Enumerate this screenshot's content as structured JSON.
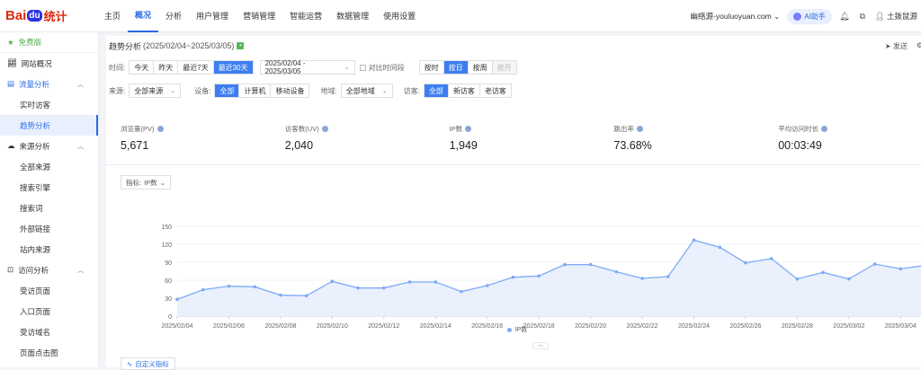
{
  "nav": {
    "logo_bai": "Bai",
    "logo_du": "du",
    "logo_tongji": "统计",
    "items": [
      "主页",
      "概况",
      "分析",
      "用户管理",
      "营销管理",
      "智能运营",
      "数据管理",
      "使用设置"
    ],
    "active_index": 1,
    "site": "幽络源-youluoyuan.com",
    "ai_label": "AI助手",
    "user": "土拨鼠源"
  },
  "sidebar": {
    "free": "免费版",
    "overview": "网站概况",
    "traffic": "流量分析",
    "traffic_items": [
      "实时访客",
      "趋势分析"
    ],
    "source": "来源分析",
    "source_items": [
      "全部来源",
      "搜索引擎",
      "搜索词",
      "外部链接",
      "站内来源"
    ],
    "visit": "访问分析",
    "visit_items": [
      "受访页面",
      "入口页面",
      "受访域名",
      "页面点击图"
    ]
  },
  "header": {
    "title": "趋势分析",
    "range": "(2025/02/04~2025/03/05)",
    "send": "发送"
  },
  "filters": {
    "time_label": "时间:",
    "time_options": [
      "今天",
      "昨天",
      "最近7天",
      "最近30天"
    ],
    "time_active": 3,
    "date_range": "2025/02/04 - 2025/03/05",
    "compare": "对比时间段",
    "gran_options": [
      "按时",
      "按日",
      "按周",
      "按月"
    ],
    "gran_active": 1,
    "gran_disabled": 3,
    "source_label": "来源:",
    "source_value": "全部来源",
    "device_label": "设备:",
    "device_options": [
      "全部",
      "计算机",
      "移动设备"
    ],
    "device_active": 0,
    "region_label": "地域:",
    "region_value": "全部地域",
    "visitor_label": "访客:",
    "visitor_options": [
      "全部",
      "新访客",
      "老访客"
    ],
    "visitor_active": 0
  },
  "metrics": [
    {
      "label": "浏览量(PV)",
      "value": "5,671"
    },
    {
      "label": "访客数(UV)",
      "value": "2,040"
    },
    {
      "label": "IP数",
      "value": "1,949"
    },
    {
      "label": "跳出率",
      "value": "73.68%"
    },
    {
      "label": "平均访问时长",
      "value": "00:03:49"
    }
  ],
  "indicator": {
    "label": "指标:",
    "value": "IP数"
  },
  "custom_metric": "自定义指标",
  "colors": {
    "accent": "#3d7ff0",
    "line": "#7eaaf5",
    "area": "#e8f0fd"
  },
  "chart_data": {
    "type": "area",
    "series": [
      {
        "name": "IP数",
        "values": [
          28,
          44,
          50,
          49,
          35,
          34,
          58,
          47,
          47,
          57,
          57,
          41,
          51,
          65,
          67,
          86,
          86,
          74,
          63,
          66,
          127,
          115,
          89,
          96,
          62,
          73,
          62,
          87,
          79,
          85
        ]
      }
    ],
    "x_tick_labels": [
      "2025/02/04",
      "2025/02/06",
      "2025/02/08",
      "2025/02/10",
      "2025/02/12",
      "2025/02/14",
      "2025/02/16",
      "2025/02/18",
      "2025/02/20",
      "2025/02/22",
      "2025/02/24",
      "2025/02/26",
      "2025/02/28",
      "2025/03/02",
      "2025/03/04"
    ],
    "yticks": [
      0,
      30,
      60,
      90,
      120,
      150
    ],
    "ylim": [
      0,
      150
    ],
    "grid": true,
    "legend": "bottom-center"
  }
}
